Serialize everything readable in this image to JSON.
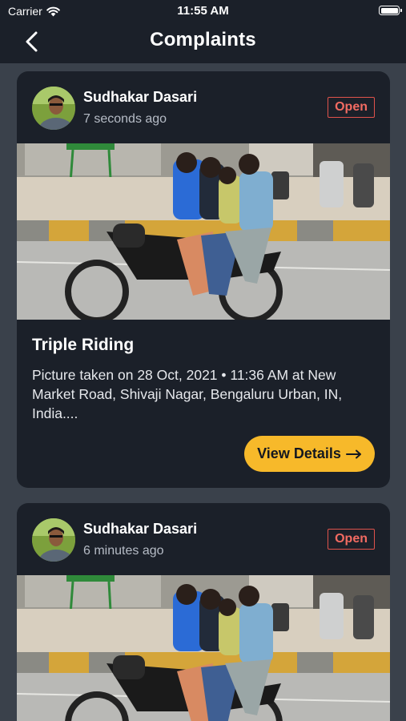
{
  "status_bar": {
    "carrier": "Carrier",
    "time": "11:55 AM",
    "wifi_icon": "wifi-icon",
    "battery_icon": "battery-icon"
  },
  "header": {
    "title": "Complaints",
    "back_icon": "chevron-left-icon"
  },
  "colors": {
    "background": "#3a414b",
    "card": "#1b2029",
    "accent": "#f7b92a",
    "status_open": "#e0534c"
  },
  "complaints": [
    {
      "author": "Sudhakar Dasari",
      "time_ago": "7 seconds ago",
      "status": "Open",
      "title": "Triple Riding",
      "description": "Picture taken on 28 Oct, 2021 • 11:36 AM at New Market Road, Shivaji Nagar, Bengaluru Urban, IN, India....",
      "details_label": "View Details",
      "details_icon": "arrow-right-icon"
    },
    {
      "author": "Sudhakar Dasari",
      "time_ago": "6 minutes ago",
      "status": "Open"
    }
  ]
}
